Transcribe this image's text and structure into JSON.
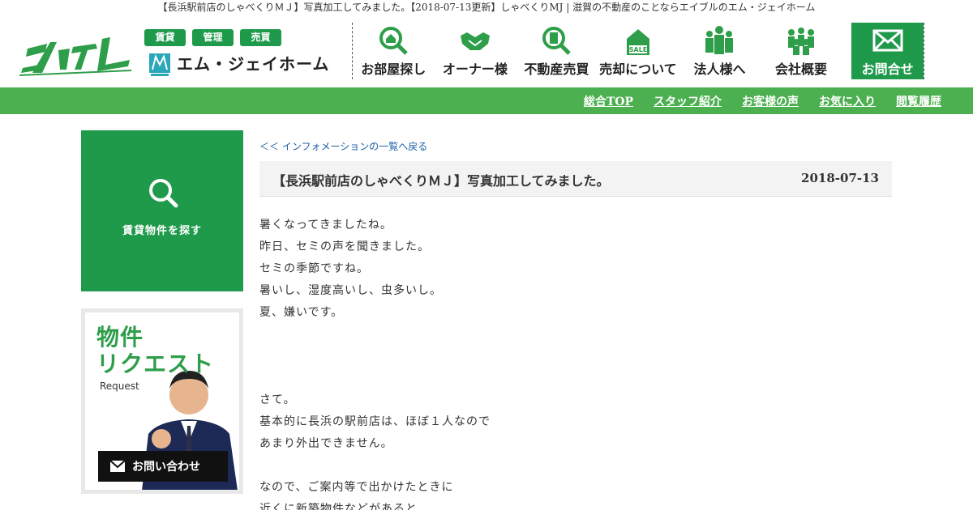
{
  "page": {
    "title": "【長浜駅前店のしゃべくりＭＪ】写真加工してみました。【2018-07-13更新】しゃべくりMJ | 滋賀の不動産のことならエイブルのエム・ジェイホーム"
  },
  "header": {
    "logo_text": "エイブル",
    "tags": [
      "賃貸",
      "管理",
      "売買"
    ],
    "company": "エム・ジェイホーム",
    "nav": [
      {
        "label": "お部屋探し",
        "icon": "house-search-icon"
      },
      {
        "label": "オーナー様",
        "icon": "handshake-icon"
      },
      {
        "label": "不動産売買",
        "icon": "building-search-icon"
      },
      {
        "label": "売却について",
        "icon": "sale-house-icon"
      },
      {
        "label": "法人様へ",
        "icon": "people-icon"
      },
      {
        "label": "会社概要",
        "icon": "group-icon"
      },
      {
        "label": "お問合せ",
        "icon": "mail-icon"
      }
    ]
  },
  "subnav": [
    "総合TOP",
    "スタッフ紹介",
    "お客様の声",
    "お気に入り",
    "閲覧履歴"
  ],
  "sidebar": {
    "search_label": "賃貸物件を探す",
    "banner": {
      "title_line1": "物件",
      "title_line2": "リクエスト",
      "subtitle": "Request",
      "button": "お問い合わせ"
    }
  },
  "post": {
    "back_link": "＜＜ インフォメーションの一覧へ戻る",
    "title": "【長浜駅前店のしゃべくりＭＪ】写真加工してみました。",
    "date": "2018-07-13",
    "lines": [
      "暑くなってきましたね。",
      "昨日、セミの声を聞きました。",
      "セミの季節ですね。",
      "暑いし、湿度高いし、虫多いし。",
      "夏、嫌いです。",
      "",
      "",
      "",
      "さて。",
      "基本的に長浜の駅前店は、ほぼ１人なので",
      "あまり外出できません。",
      "",
      "なので、ご案内等で出かけたときに",
      "近くに新築物件などがあると"
    ]
  },
  "colors": {
    "brand_green": "#1f9a4a",
    "subbar_green": "#4caf50",
    "link_blue": "#1a5fa8"
  }
}
